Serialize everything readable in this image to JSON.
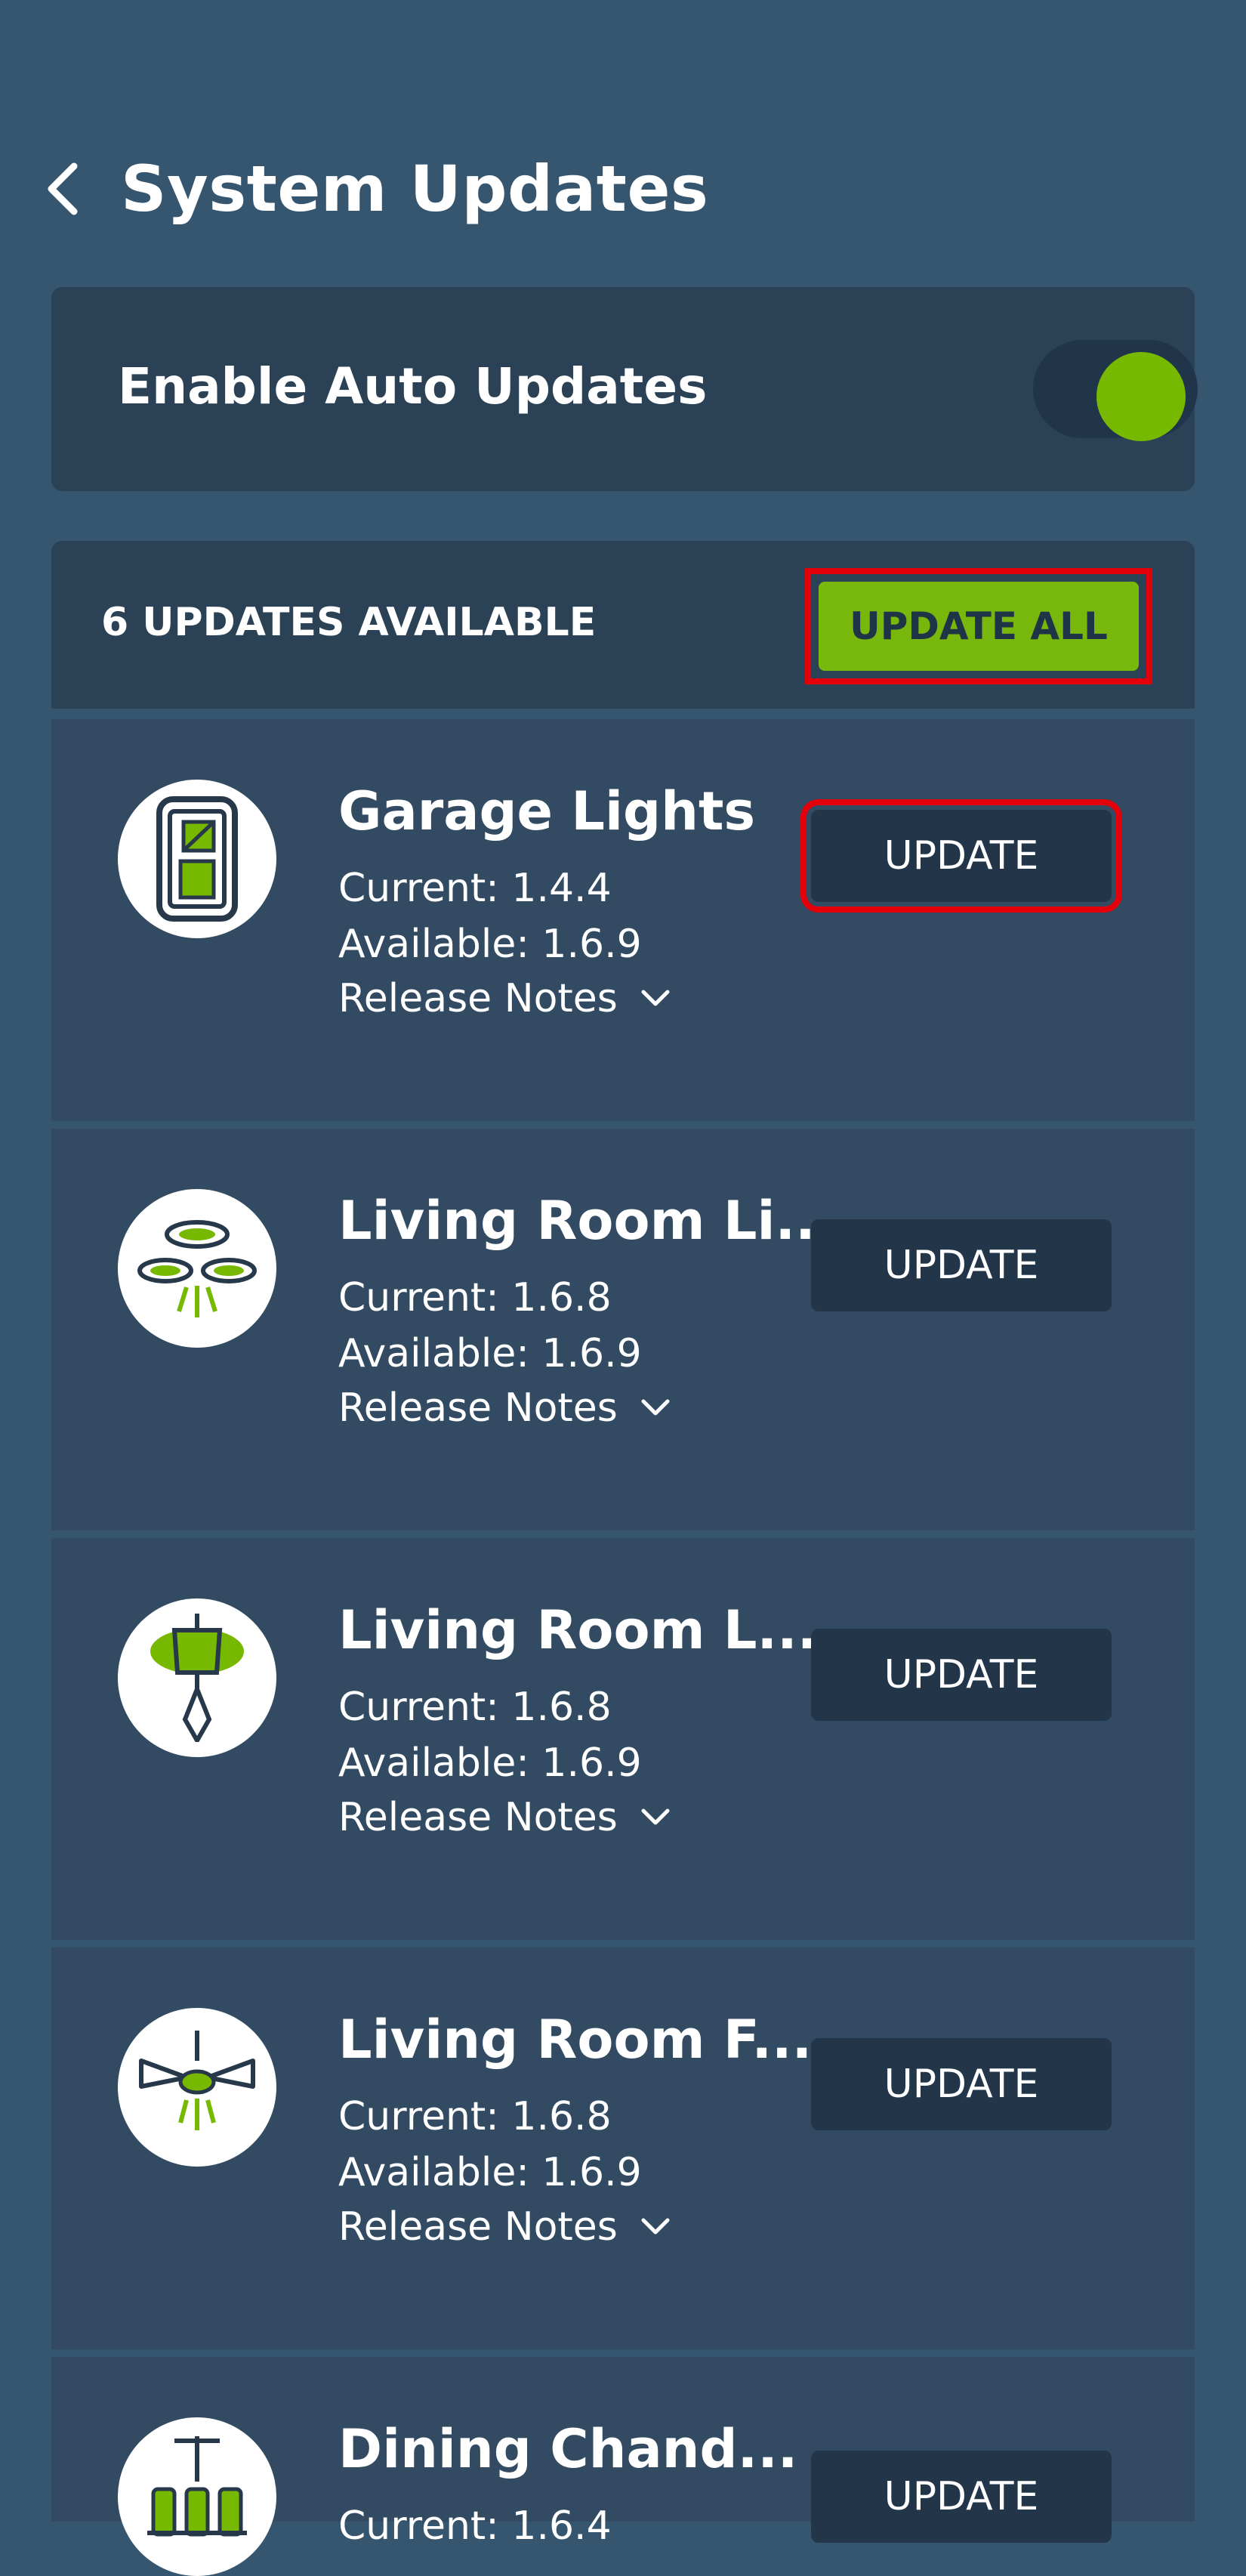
{
  "header": {
    "title": "System Updates",
    "back_icon": "chevron-left-icon"
  },
  "auto_updates": {
    "label": "Enable Auto Updates",
    "enabled": true,
    "accent": "#77b800"
  },
  "updates": {
    "count_label": "6 UPDATES AVAILABLE",
    "update_all_label": "UPDATE ALL"
  },
  "devices": [
    {
      "name": "Garage Lights",
      "current": "Current: 1.4.4",
      "available": "Available: 1.6.9",
      "notes": "Release Notes",
      "button": "UPDATE",
      "icon": "switch-icon"
    },
    {
      "name": "Living Room Li...",
      "current": "Current: 1.6.8",
      "available": "Available: 1.6.9",
      "notes": "Release Notes",
      "button": "UPDATE",
      "icon": "recessed-lights-icon"
    },
    {
      "name": "Living Room L...",
      "current": "Current: 1.6.8",
      "available": "Available: 1.6.9",
      "notes": "Release Notes",
      "button": "UPDATE",
      "icon": "pendant-lamp-icon"
    },
    {
      "name": "Living Room F...",
      "current": "Current: 1.6.8",
      "available": "Available: 1.6.9",
      "notes": "Release Notes",
      "button": "UPDATE",
      "icon": "ceiling-fan-icon"
    },
    {
      "name": "Dining Chand...",
      "current": "Current: 1.6.4",
      "available": "",
      "notes": "",
      "button": "UPDATE",
      "icon": "chandelier-icon"
    }
  ],
  "colors": {
    "background": "#36556f",
    "card": "#2b4256",
    "row": "#324b62",
    "button": "#223549",
    "highlight": "#e3000b"
  }
}
